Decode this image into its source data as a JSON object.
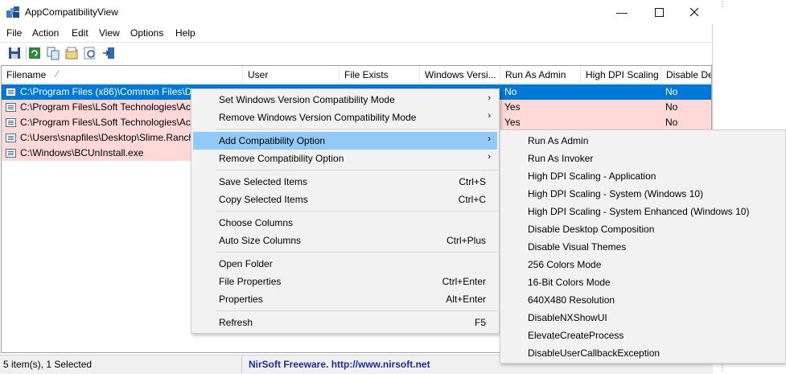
{
  "window": {
    "title": "AppCompatibilityView"
  },
  "menu": [
    "File",
    "Action",
    "Edit",
    "View",
    "Options",
    "Help"
  ],
  "toolbar": [
    "save-icon",
    "refresh-icon",
    "copy-icon",
    "properties-icon",
    "find-icon",
    "exit-icon"
  ],
  "columns": [
    "Filename",
    "User",
    "File Exists",
    "Windows Versi...",
    "Run As Admin",
    "High DPI Scaling",
    "Disable Des"
  ],
  "sort_indicator": "⁄",
  "rows": [
    {
      "filename": "C:\\Program Files (x86)\\Common Files\\D",
      "run_as_admin": "No",
      "disable": "No",
      "selected": true
    },
    {
      "filename": "C:\\Program Files\\LSoft Technologies\\Act",
      "run_as_admin": "Yes",
      "disable": "No",
      "selected": false
    },
    {
      "filename": "C:\\Program Files\\LSoft Technologies\\Act",
      "run_as_admin": "Yes",
      "disable": "No",
      "selected": false
    },
    {
      "filename": "C:\\Users\\snapfiles\\Desktop\\Slime.Ranch",
      "run_as_admin": "",
      "disable": "",
      "selected": false
    },
    {
      "filename": "C:\\Windows\\BCUnInstall.exe",
      "run_as_admin": "",
      "disable": "",
      "selected": false
    }
  ],
  "context_menu": [
    {
      "label": "Set Windows Version Compatibility Mode",
      "shortcut": "",
      "submenu": true
    },
    {
      "label": "Remove Windows Version Compatibility Mode",
      "shortcut": "",
      "submenu": true
    },
    {
      "label": "Add Compatibility Option",
      "shortcut": "",
      "submenu": true,
      "highlighted": true
    },
    {
      "label": "Remove Compatibility Option",
      "shortcut": "",
      "submenu": true
    },
    {
      "label": "Save Selected Items",
      "shortcut": "Ctrl+S"
    },
    {
      "label": "Copy Selected Items",
      "shortcut": "Ctrl+C"
    },
    {
      "label": "Choose Columns",
      "shortcut": ""
    },
    {
      "label": "Auto Size Columns",
      "shortcut": "Ctrl+Plus"
    },
    {
      "label": "Open Folder",
      "shortcut": ""
    },
    {
      "label": "File Properties",
      "shortcut": "Ctrl+Enter"
    },
    {
      "label": "Properties",
      "shortcut": "Alt+Enter"
    },
    {
      "label": "Refresh",
      "shortcut": "F5"
    }
  ],
  "submenu": [
    "Run As Admin",
    "Run As Invoker",
    "High DPI Scaling - Application",
    "High DPI Scaling - System (Windows 10)",
    "High DPI Scaling - System Enhanced (Windows 10)",
    "Disable Desktop Composition",
    "Disable Visual Themes",
    "256 Colors Mode",
    "16-Bit Colors Mode",
    "640X480 Resolution",
    "DisableNXShowUI",
    "ElevateCreateProcess",
    "DisableUserCallbackException"
  ],
  "status": {
    "items": "5 item(s), 1 Selected",
    "brand": "NirSoft Freeware.  http://www.nirsoft.net"
  },
  "colors": {
    "selected_row": "#0078d7",
    "pink_row": "#ffd8d8",
    "menu_highlight": "#91c9f7",
    "status_link": "#1a2c9a"
  }
}
